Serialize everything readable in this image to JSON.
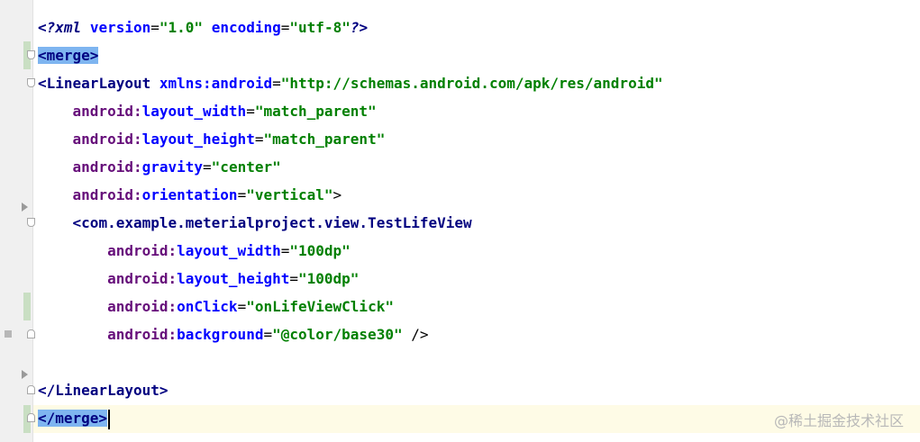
{
  "editor": {
    "language": "xml",
    "colors": {
      "tag": "#000080",
      "namespace": "#660e7a",
      "attribute": "#0000ff",
      "value": "#008000",
      "tag_highlight": "#7eb5f0",
      "caret_line": "#fefbe6"
    },
    "lines": [
      {
        "decl_open": "<?",
        "decl_name": "xml",
        "a1": "version",
        "eq1": "=",
        "v1": "\"1.0\"",
        "a2": "encoding",
        "eq2": "=",
        "v2": "\"utf-8\"",
        "decl_close": "?>"
      },
      {
        "text": "<merge>"
      },
      {
        "open": "<",
        "tag": "LinearLayout",
        "ns": "xmlns:",
        "attr": "android",
        "eq": "=",
        "val": "\"http://schemas.android.com/apk/res/android\""
      },
      {
        "indent": "    ",
        "ns": "android:",
        "attr": "layout_width",
        "eq": "=",
        "val": "\"match_parent\""
      },
      {
        "indent": "    ",
        "ns": "android:",
        "attr": "layout_height",
        "eq": "=",
        "val": "\"match_parent\""
      },
      {
        "indent": "    ",
        "ns": "android:",
        "attr": "gravity",
        "eq": "=",
        "val": "\"center\""
      },
      {
        "indent": "    ",
        "ns": "android:",
        "attr": "orientation",
        "eq": "=",
        "val": "\"vertical\"",
        "close": ">"
      },
      {
        "indent": "    ",
        "open": "<",
        "tag": "com.example.meterialproject.view.TestLifeView"
      },
      {
        "indent": "        ",
        "ns": "android:",
        "attr": "layout_width",
        "eq": "=",
        "val": "\"100dp\""
      },
      {
        "indent": "        ",
        "ns": "android:",
        "attr": "layout_height",
        "eq": "=",
        "val": "\"100dp\""
      },
      {
        "indent": "        ",
        "ns": "android:",
        "attr": "onClick",
        "eq": "=",
        "val": "\"onLifeViewClick\""
      },
      {
        "indent": "        ",
        "ns": "android:",
        "attr": "background",
        "eq": "=",
        "val": "\"@color/base30\"",
        "close": " />"
      },
      {
        "text": ""
      },
      {
        "open": "</",
        "tag": "LinearLayout",
        "close": ">"
      },
      {
        "text": "</merge>"
      }
    ]
  },
  "watermark": "@稀土掘金技术社区"
}
